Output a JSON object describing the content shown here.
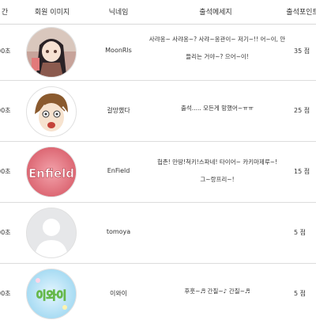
{
  "header": {
    "time": "간",
    "avatar": "회원 이미지",
    "nickname": "닉네임",
    "message": "출석메세지",
    "points": "출석포인트"
  },
  "rows": [
    {
      "time": "00초",
      "avatar_icon": "anime-girl-avatar",
      "nickname": "MoonRls",
      "message_line1": "사랴옹~ 사랴옹~? 사랴~옹관이~ 저기~!! 어~이, 안",
      "message_line2": "들리는 거야~? 으어~이!",
      "points": "35 점"
    },
    {
      "time": "00초",
      "avatar_icon": "anime-boy-avatar",
      "nickname": "걸망했다",
      "message_line1": "출석..... 모든게 망했어~ㅠㅠ",
      "message_line2": "",
      "points": "25 점"
    },
    {
      "time": "00초",
      "avatar_icon": "enfield-text-avatar",
      "avatar_text": "Enfield",
      "nickname": "EnField",
      "message_line1": "헙존! 만땅!척키!스파네! 타이어~ 카키마제루~!",
      "message_line2": "그~랑프리~!",
      "points": "15 점"
    },
    {
      "time": "00초",
      "avatar_icon": "default-user-avatar",
      "nickname": "tomoya",
      "message_line1": "",
      "message_line2": "",
      "points": "5 점"
    },
    {
      "time": "00초",
      "avatar_icon": "iwaai-text-avatar",
      "avatar_text": "이와이",
      "nickname": "이와이",
      "message_line1": "후훗~♬ 간질~♪ 간질~♬",
      "message_line2": "",
      "points": "5 점"
    }
  ]
}
